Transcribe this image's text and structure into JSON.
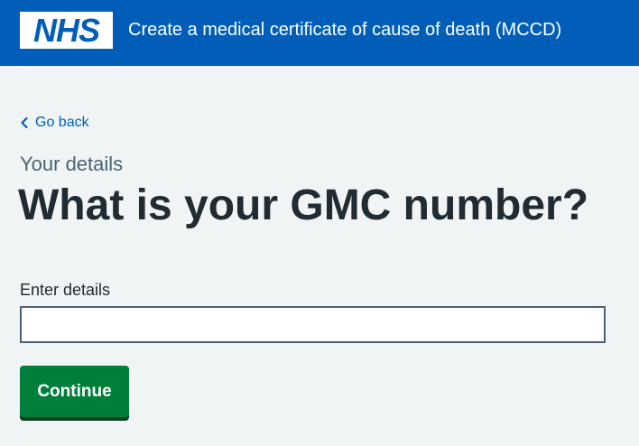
{
  "header": {
    "logo_text": "NHS",
    "service_name": "Create a medical certificate of cause of death (MCCD)",
    "brand_color": "#005eb8"
  },
  "nav": {
    "back_label": "Go back",
    "back_icon": "chevron-left-icon"
  },
  "main": {
    "caption": "Your details",
    "title": "What is your GMC number?",
    "field_label": "Enter details",
    "field_value": "",
    "continue_label": "Continue",
    "button_color": "#007f3b"
  }
}
